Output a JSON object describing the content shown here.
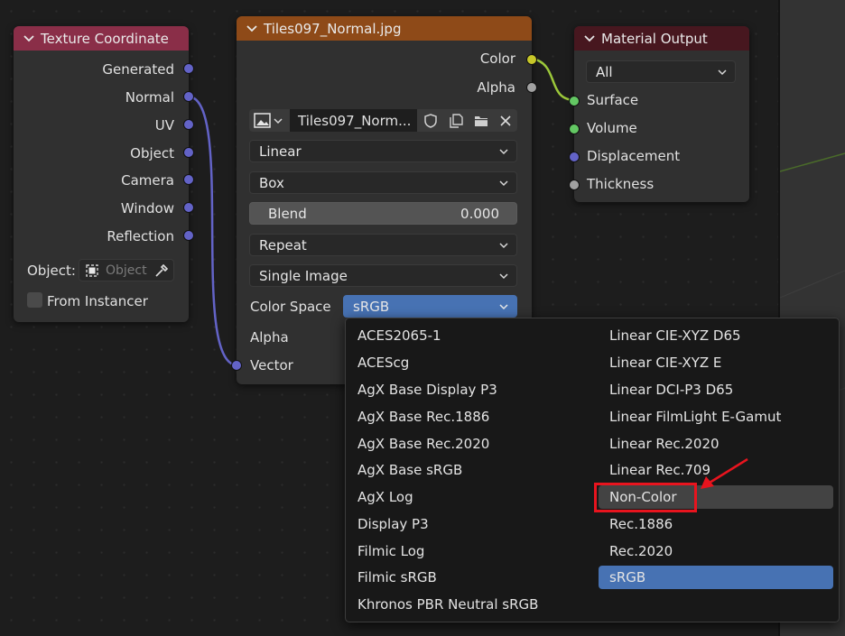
{
  "texture_coordinate": {
    "title": "Texture Coordinate",
    "outputs": [
      "Generated",
      "Normal",
      "UV",
      "Object",
      "Camera",
      "Window",
      "Reflection"
    ],
    "object_label": "Object:",
    "object_placeholder": "Object",
    "from_instancer": "From Instancer"
  },
  "image_node": {
    "title": "Tiles097_Normal.jpg",
    "outputs": [
      "Color",
      "Alpha"
    ],
    "image_name": "Tiles097_Norm...",
    "interpolation": "Linear",
    "projection": "Box",
    "blend_label": "Blend",
    "blend_value": "0.000",
    "extension": "Repeat",
    "source": "Single Image",
    "color_space_label": "Color Space",
    "color_space_value": "sRGB",
    "alpha_label": "Alpha",
    "vector_label": "Vector"
  },
  "material_output": {
    "title": "Material Output",
    "target": "All",
    "inputs": [
      "Surface",
      "Volume",
      "Displacement",
      "Thickness"
    ]
  },
  "color_space_menu": {
    "left": [
      "ACES2065-1",
      "ACEScg",
      "AgX Base Display P3",
      "AgX Base Rec.1886",
      "AgX Base Rec.2020",
      "AgX Base sRGB",
      "AgX Log",
      "Display P3",
      "Filmic Log",
      "Filmic sRGB",
      "Khronos PBR Neutral sRGB"
    ],
    "right": [
      "Linear CIE-XYZ D65",
      "Linear CIE-XYZ E",
      "Linear DCI-P3 D65",
      "Linear FilmLight E-Gamut",
      "Linear Rec.2020",
      "Linear Rec.709",
      "Non-Color",
      "Rec.1886",
      "Rec.2020",
      "sRGB"
    ],
    "hovered": "Non-Color",
    "selected": "sRGB"
  },
  "colors": {
    "texcoord_header": "#8a2e48",
    "image_header": "#8e4a18",
    "output_header": "#47171f",
    "vector_socket": "#6363c7",
    "color_socket": "#c7c729",
    "float_socket": "#a1a1a1",
    "shader_socket": "#63c763",
    "menu_highlight": "#4772b3",
    "annotation_red": "#e8141e"
  }
}
